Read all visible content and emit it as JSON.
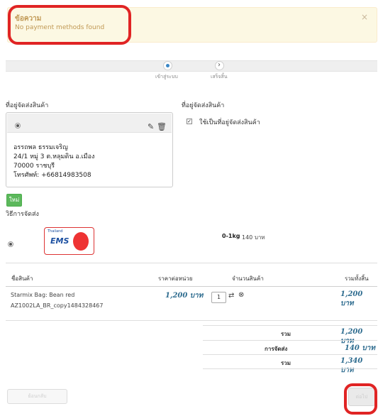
{
  "alert": {
    "title": "ข้อความ",
    "message": "No payment methods found",
    "close": "×"
  },
  "steps": [
    {
      "label": "เข้าสู่ระบบ",
      "state": "current"
    },
    {
      "label": "เสร็จสิ้น",
      "state": "next"
    }
  ],
  "shipping_address": {
    "title": "ที่อยู่จัดส่งสินค้า",
    "name": "อรรถพล ธรรมเจริญ",
    "line1": "24/1 หมู่ 3 ต.หลุมดิน อ.เมือง",
    "line2": "70000 ราชบุรี",
    "phone": "โทรศัพท์: +66814983508",
    "edit_icon": "pencil-icon",
    "delete_icon": "trash-icon"
  },
  "billing_address": {
    "title": "ที่อยู่จัดส่งสินค้า",
    "checkbox_label": "ใช้เป็นที่อยู่จัดส่งสินค้า",
    "checked": true
  },
  "new_button": "ใหม่",
  "shipping_method": {
    "title": "วิธีการจัดส่ง",
    "logo_text": "EMS",
    "logo_small": "Thailand",
    "weight": "0-1kg",
    "price": "140 บาท"
  },
  "cart": {
    "headers": {
      "name": "ชื่อสินค้า",
      "unit_price": "ราคาต่อหน่วย",
      "quantity": "จำนวนสินค้า",
      "total": "รวมทั้งสิ้น"
    },
    "items": [
      {
        "name": "Starmix Bag: Bean red",
        "sku": "AZ1002LA_BR_copy1484328467",
        "unit_price": "1,200 บาท",
        "quantity": "1",
        "total": "1,200 บาท"
      }
    ],
    "summary": [
      {
        "label": "รวม",
        "value": "1,200 บาท"
      },
      {
        "label": "การจัดส่ง",
        "value": "140 บาท"
      },
      {
        "label": "รวม",
        "value": "1,340 บาท"
      }
    ]
  },
  "buttons": {
    "back": "ย้อนกลับ",
    "next": "ต่อไป"
  },
  "colors": {
    "alert_bg": "#fcf8e3",
    "alert_text": "#c09853",
    "price": "#2e6c8f",
    "green": "#5cb85c",
    "annotation_red": "#e02424"
  }
}
